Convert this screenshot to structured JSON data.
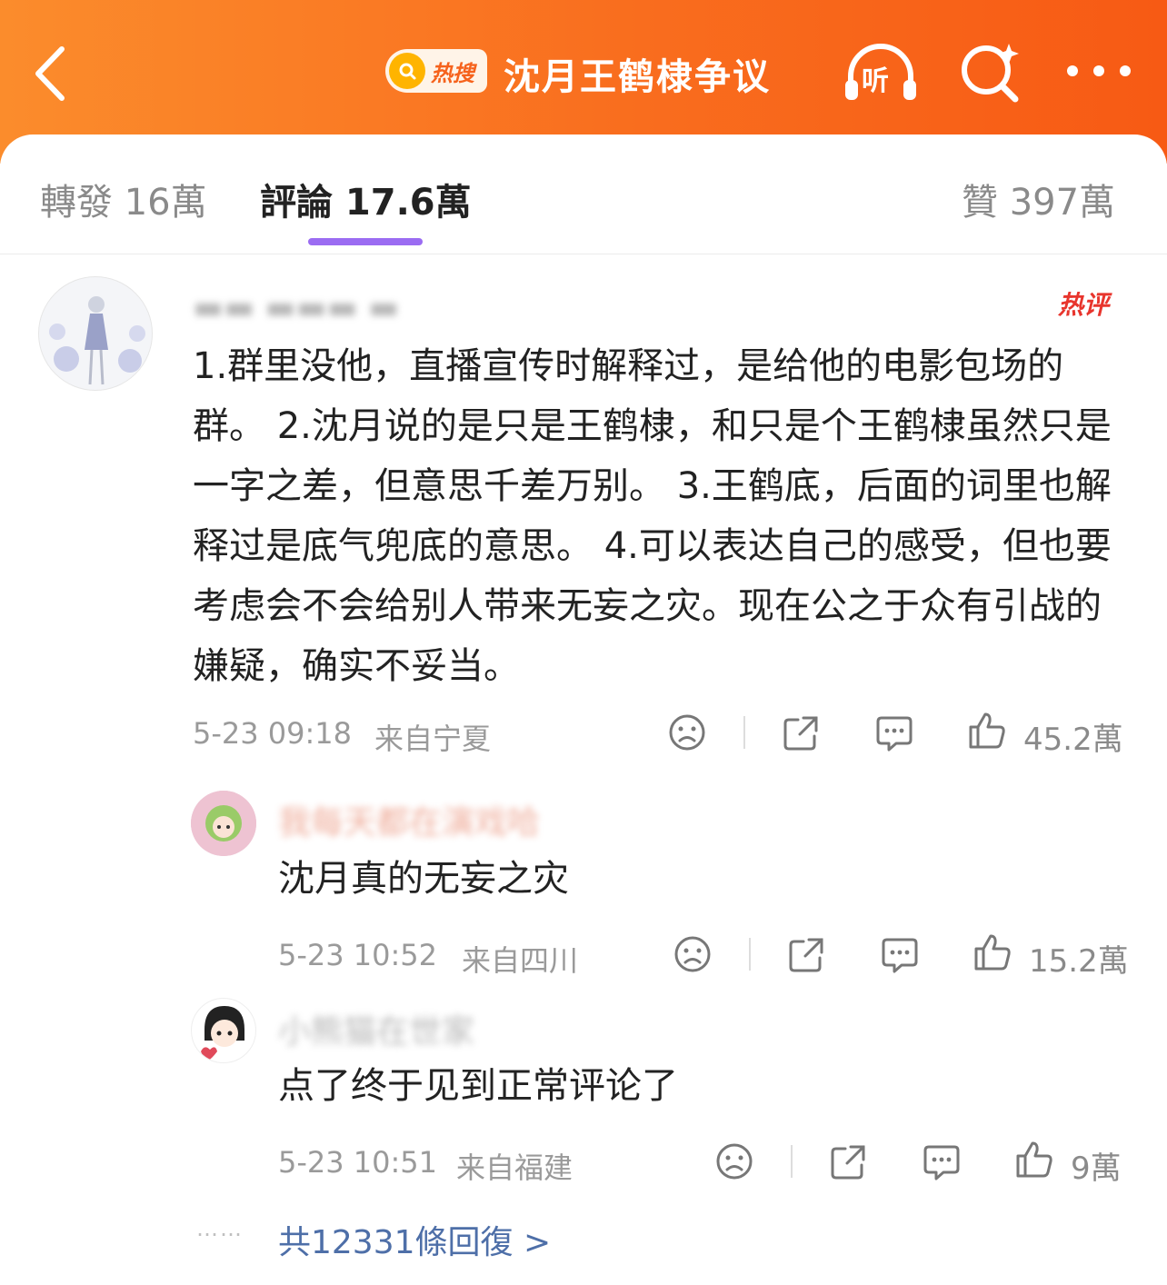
{
  "header": {
    "hot_search_label": "热搜",
    "title": "沈月王鹤棣争议",
    "listen_label": "听",
    "colors": {
      "start": "#fb8c2c",
      "end": "#f75a14"
    }
  },
  "tabs": [
    {
      "label": "轉發 16萬"
    },
    {
      "label": "評論 17.6萬"
    },
    {
      "label": "贊 397萬"
    }
  ],
  "main_comment": {
    "hot_tag": "热评",
    "text": "1.群里没他，直播宣传时解释过，是给他的电影包场的群。  2.沈月说的是只是王鹤棣，和只是个王鹤棣虽然只是一字之差，但意思千差万别。  3.王鹤底，后面的词里也解释过是底气兜底的意思。  4.可以表达自己的感受，但也要考虑会不会给别人带来无妄之灾。现在公之于众有引战的嫌疑，确实不妥当。",
    "time": "5-23 09:18",
    "location": "来自宁夏",
    "likes": "45.2萬"
  },
  "replies": [
    {
      "username": "我每天都在演戏哈",
      "text": "沈月真的无妄之灾",
      "time": "5-23 10:52",
      "location": "来自四川",
      "likes": "15.2萬"
    },
    {
      "username": "小熊猫在世家",
      "text": "点了终于见到正常评论了",
      "time": "5-23 10:51",
      "location": "来自福建",
      "likes": "9萬"
    }
  ],
  "more_dots": "……",
  "more_replies": "共12331條回復 >"
}
